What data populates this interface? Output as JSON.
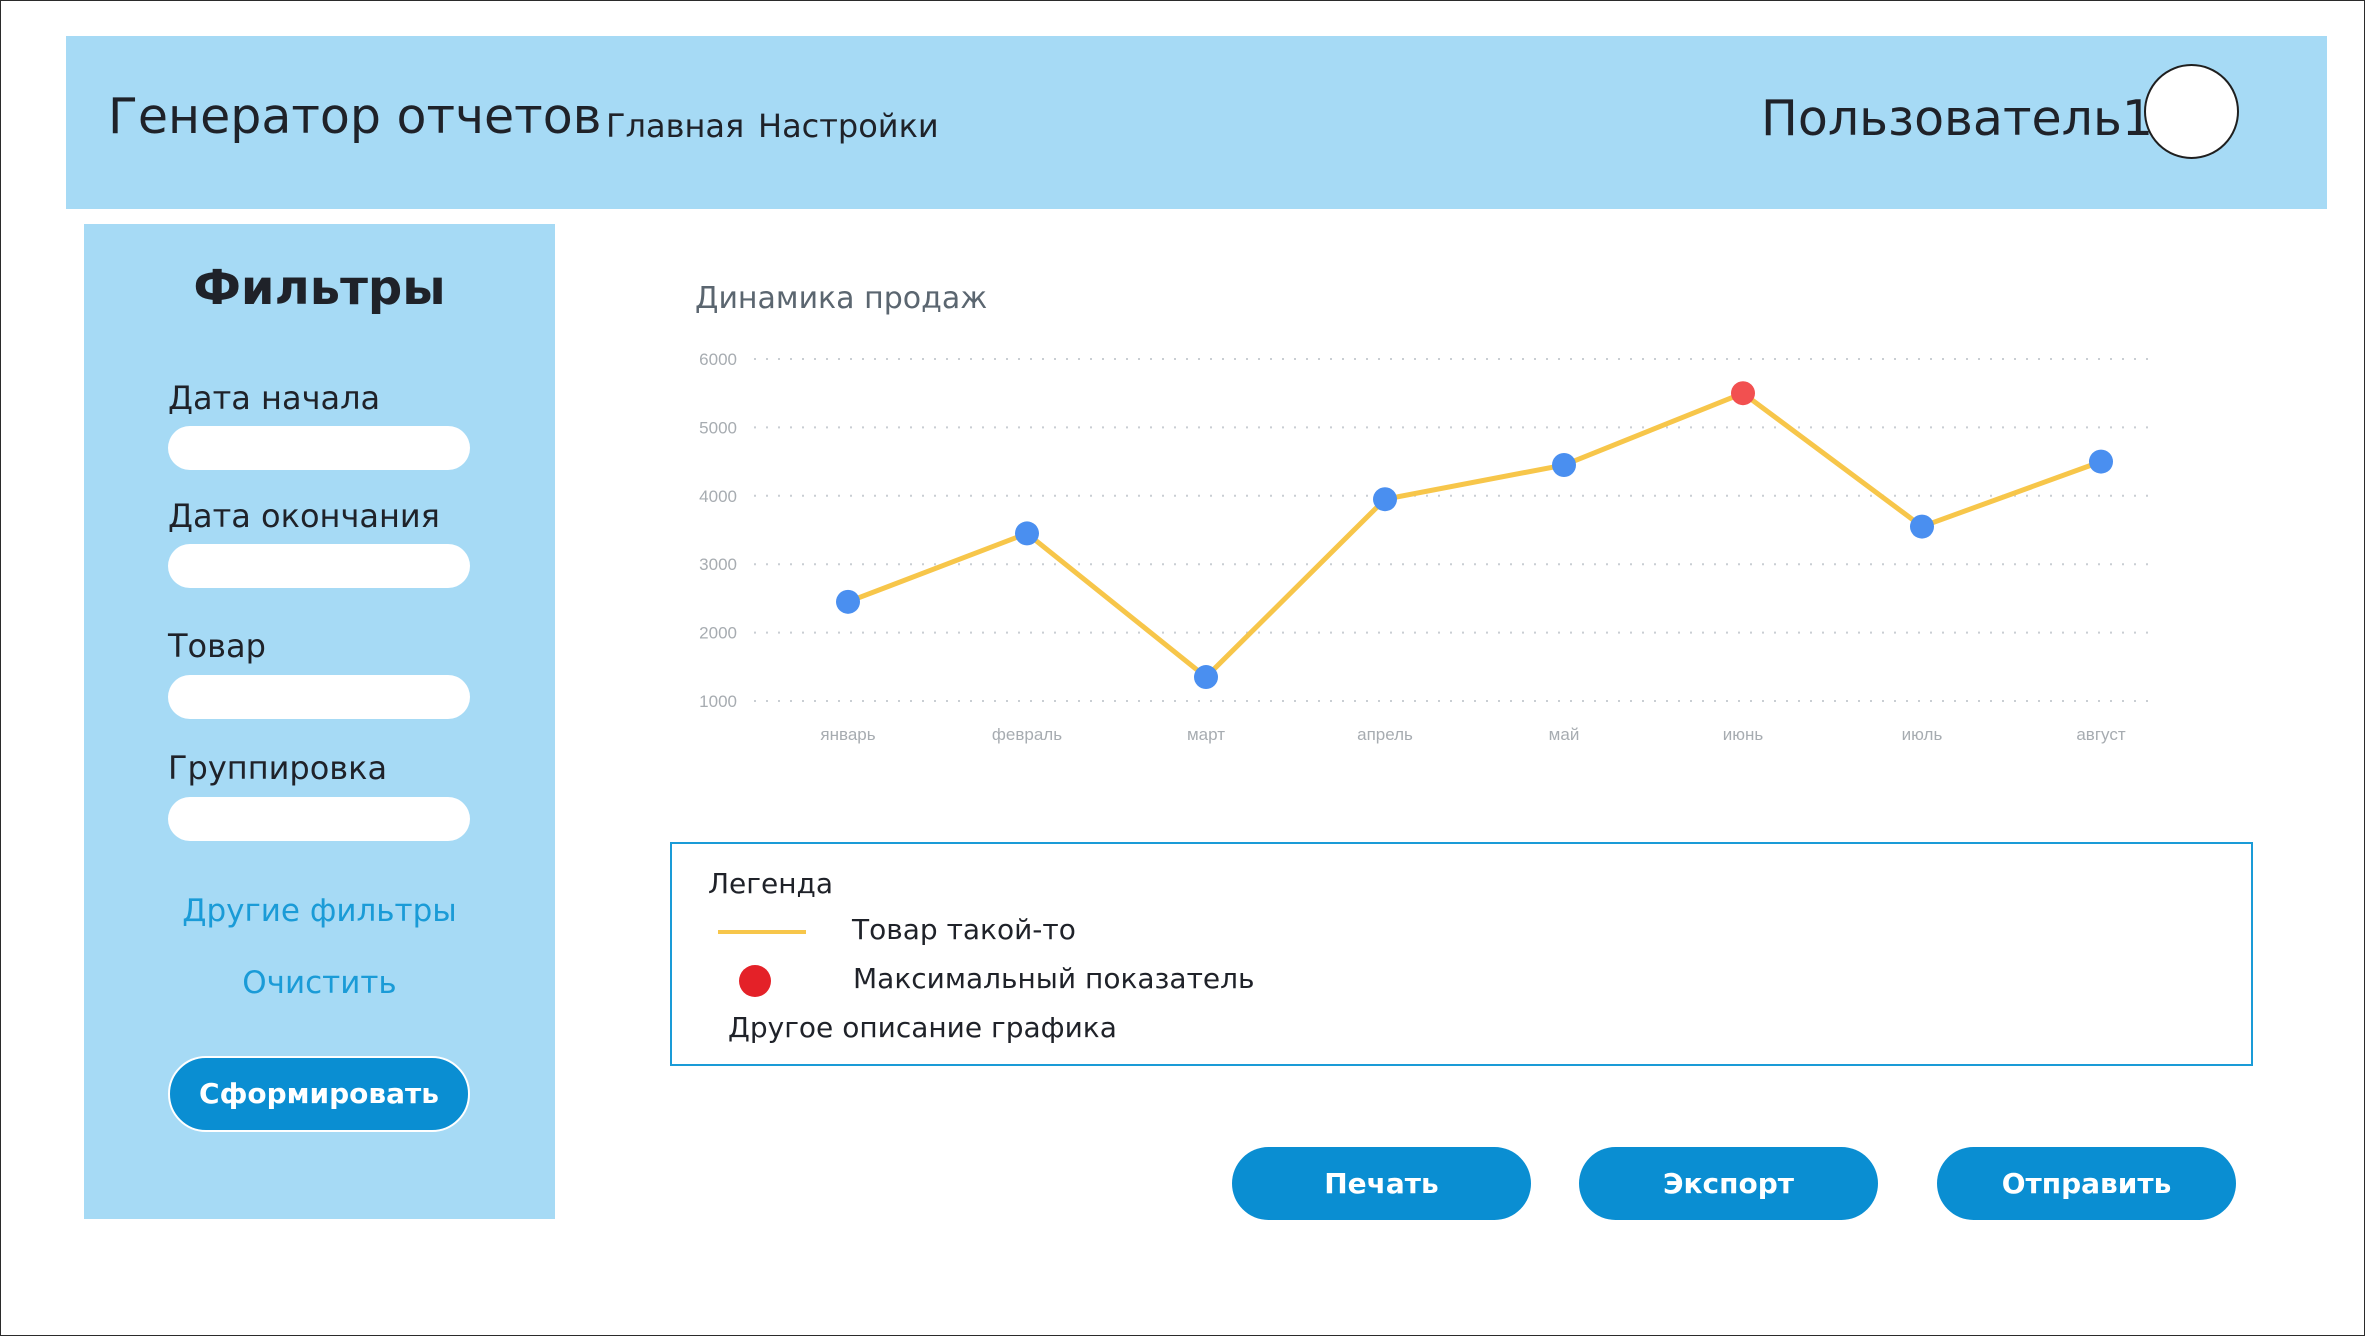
{
  "header": {
    "app_title": "Генератор отчетов",
    "nav": {
      "home": "Главная",
      "settings": "Настройки"
    },
    "username": "Пользователь1"
  },
  "sidebar": {
    "title": "Фильтры",
    "fields": [
      {
        "label": "Дата начала",
        "value": "",
        "placeholder": ""
      },
      {
        "label": "Дата окончания",
        "value": "",
        "placeholder": ""
      },
      {
        "label": "Товар",
        "value": "",
        "placeholder": ""
      },
      {
        "label": "Группировка",
        "value": "",
        "placeholder": ""
      }
    ],
    "more_filters": "Другие фильтры",
    "clear": "Очистить",
    "generate": "Сформировать"
  },
  "chart_data": {
    "type": "line",
    "title": "Динамика продаж",
    "categories": [
      "январь",
      "февраль",
      "март",
      "апрель",
      "май",
      "июнь",
      "июль",
      "август"
    ],
    "series": [
      {
        "name": "Товар такой-то",
        "values": [
          2450,
          3450,
          1350,
          3950,
          4450,
          5500,
          3550,
          4500
        ]
      }
    ],
    "highlight_index": 5,
    "ylim": [
      1000,
      6000
    ],
    "yticks": [
      1000,
      2000,
      3000,
      4000,
      5000,
      6000
    ],
    "grid": true,
    "colors": {
      "line": "#f7c64a",
      "point": "#4a8ff0",
      "max_point": "#f25050",
      "grid": "#c9ced3",
      "tick": "#a7acb1"
    }
  },
  "legend": {
    "title": "Легенда",
    "line_label": "Товар такой-то",
    "max_label": "Максимальный показатель",
    "description": "Другое описание графика"
  },
  "actions": {
    "print": "Печать",
    "export": "Экспорт",
    "send": "Отправить"
  },
  "colors": {
    "panel": "#a6daf5",
    "accent": "#0a8ed2",
    "link": "#1a9bd7"
  }
}
